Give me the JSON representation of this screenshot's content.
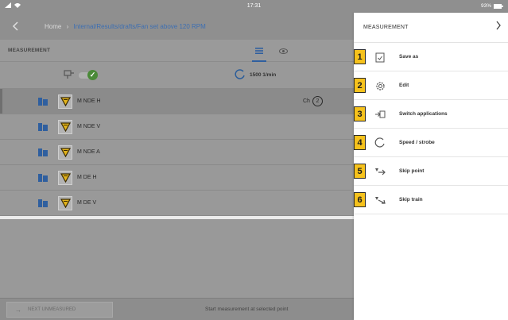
{
  "status_bar": {
    "time": "17:31",
    "battery": "93%"
  },
  "header": {
    "home": "Home",
    "separator": "›",
    "path": "Internal/Results/drafts/Fan set above 120 RPM"
  },
  "table": {
    "title": "MEASUREMENT",
    "speed": "1500 1/min",
    "rows": [
      {
        "label": "M NDE H",
        "channel_prefix": "Ch",
        "channel": "2",
        "selected": true
      },
      {
        "label": "M NDE V"
      },
      {
        "label": "M NDE A"
      },
      {
        "label": "M DE H"
      },
      {
        "label": "M DE V"
      }
    ]
  },
  "footer": {
    "next_label": "NEXT UNMEASURED",
    "hint": "Start measurement at selected point"
  },
  "panel": {
    "title": "MEASUREMENT",
    "items": [
      {
        "num": "1",
        "label": "Save as",
        "icon": "save-icon"
      },
      {
        "num": "2",
        "label": "Edit",
        "icon": "gear-icon"
      },
      {
        "num": "3",
        "label": "Switch applications",
        "icon": "switch-apps-icon"
      },
      {
        "num": "4",
        "label": "Speed / strobe",
        "icon": "speed-refresh-icon"
      },
      {
        "num": "5",
        "label": "Skip point",
        "icon": "skip-point-icon"
      },
      {
        "num": "6",
        "label": "Skip train",
        "icon": "skip-train-icon"
      }
    ]
  },
  "colors": {
    "accent_blue": "#2f5f9f",
    "badge_yellow": "#f6c21c",
    "ok_green": "#4a8a38"
  }
}
